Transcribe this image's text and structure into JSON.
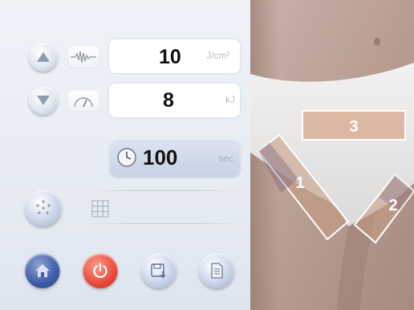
{
  "energy": {
    "value": "10",
    "unit": "J/cm²"
  },
  "total": {
    "value": "8",
    "unit": "kJ"
  },
  "timer": {
    "value": "100",
    "unit": "sec"
  },
  "zones": [
    {
      "label": "1"
    },
    {
      "label": "2"
    },
    {
      "label": "3"
    }
  ],
  "colors": {
    "home_button": "#3d5aa5",
    "power_button": "#e8493a",
    "zone_outline": "#ffffff"
  },
  "icons": {
    "up": "arrow-up-icon",
    "down": "arrow-down-icon",
    "waveform": "waveform-icon",
    "gauge": "gauge-icon",
    "clock": "clock-icon",
    "dots": "dots-icon",
    "grid": "grid-icon",
    "home": "home-icon",
    "power": "power-icon",
    "save": "save-icon",
    "document": "document-icon"
  }
}
